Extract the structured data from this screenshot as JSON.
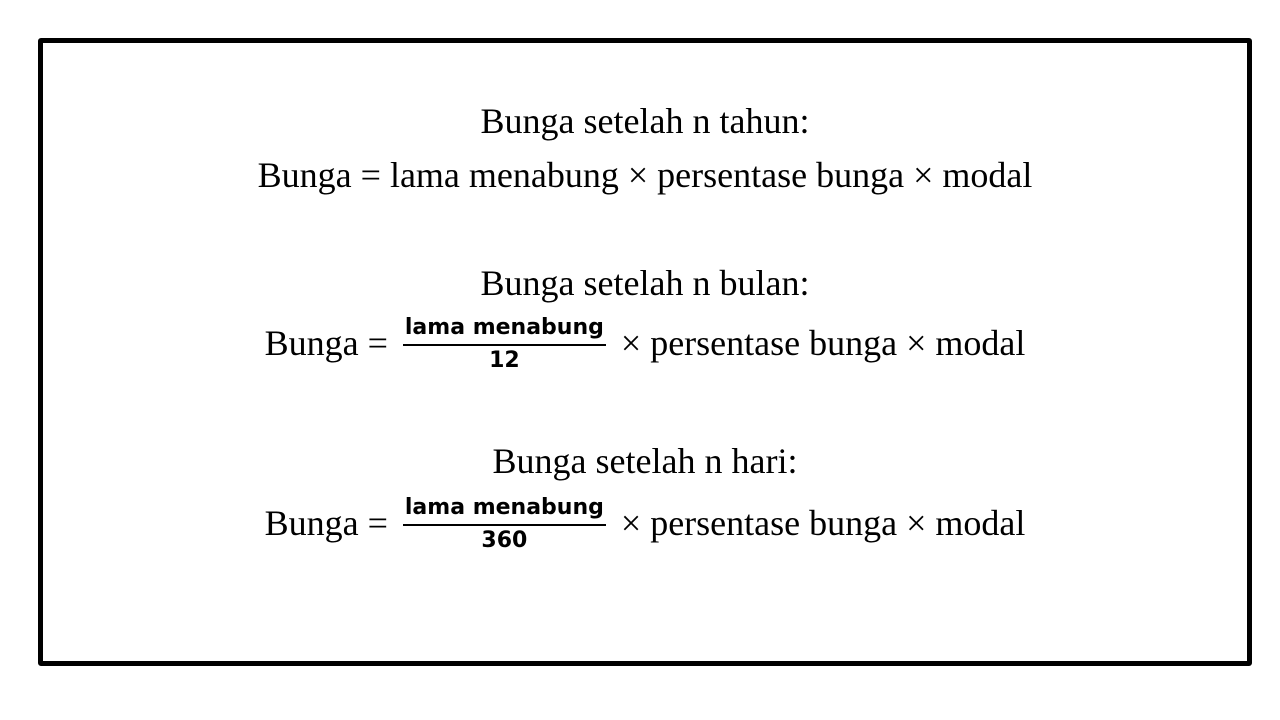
{
  "sections": [
    {
      "heading": "Bunga setelah n tahun:",
      "lhs": "Bunga = ",
      "rhs": "lama menabung × persentase bunga × modal"
    },
    {
      "heading": "Bunga setelah n bulan:",
      "lhs": "Bunga = ",
      "numerator": "lama menabung",
      "denominator": "12",
      "rhs": " × persentase bunga × modal"
    },
    {
      "heading": "Bunga setelah n hari:",
      "lhs": "Bunga = ",
      "numerator": "lama menabung",
      "denominator": "360",
      "rhs": " × persentase bunga × modal"
    }
  ]
}
